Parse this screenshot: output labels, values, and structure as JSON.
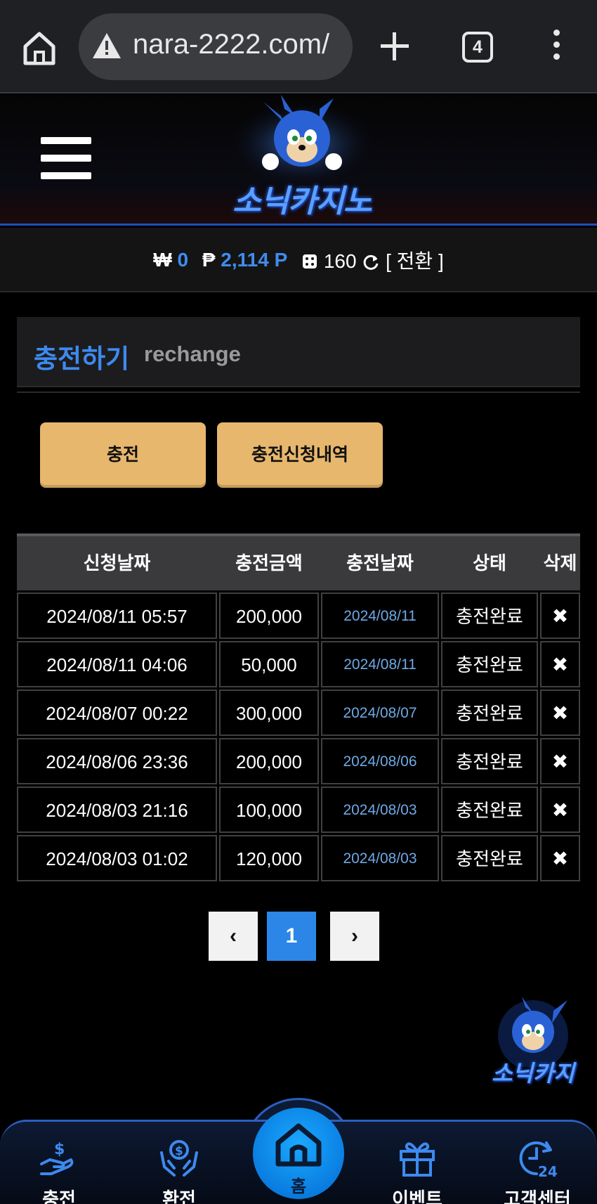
{
  "browser": {
    "url": "nara-2222.com/",
    "tab_count": "4"
  },
  "site": {
    "logo_text": "소닉카지노"
  },
  "balance": {
    "won_symbol": "₩",
    "won_value": "0",
    "point_symbol": "₱",
    "point_value": "2,114 P",
    "chip_value": "160",
    "convert_label": "[ 전환 ]"
  },
  "section": {
    "title_ko": "충전하기",
    "title_en": "rechange"
  },
  "buttons": {
    "charge": "충전",
    "history": "충전신청내역"
  },
  "table": {
    "headers": [
      "신청날짜",
      "충전금액",
      "충전날짜",
      "상태",
      "삭제"
    ],
    "rows": [
      {
        "request_date": "2024/08/11 05:57",
        "amount": "200,000",
        "charge_date": "2024/08/11",
        "status": "충전완료",
        "delete": "✖"
      },
      {
        "request_date": "2024/08/11 04:06",
        "amount": "50,000",
        "charge_date": "2024/08/11",
        "status": "충전완료",
        "delete": "✖"
      },
      {
        "request_date": "2024/08/07 00:22",
        "amount": "300,000",
        "charge_date": "2024/08/07",
        "status": "충전완료",
        "delete": "✖"
      },
      {
        "request_date": "2024/08/06 23:36",
        "amount": "200,000",
        "charge_date": "2024/08/06",
        "status": "충전완료",
        "delete": "✖"
      },
      {
        "request_date": "2024/08/03 21:16",
        "amount": "100,000",
        "charge_date": "2024/08/03",
        "status": "충전완료",
        "delete": "✖"
      },
      {
        "request_date": "2024/08/03 01:02",
        "amount": "120,000",
        "charge_date": "2024/08/03",
        "status": "충전완료",
        "delete": "✖"
      }
    ]
  },
  "pagination": {
    "prev": "‹",
    "current": "1",
    "next": "›"
  },
  "floating": {
    "logo_text": "소닉카지"
  },
  "bottom_nav": {
    "charge": "충전",
    "exchange": "환전",
    "home": "홈",
    "event": "이벤트",
    "support": "고객센터"
  },
  "colors": {
    "accent_blue": "#3d8af0",
    "gold_button": "#e7b76d",
    "page_bg": "#000000"
  }
}
